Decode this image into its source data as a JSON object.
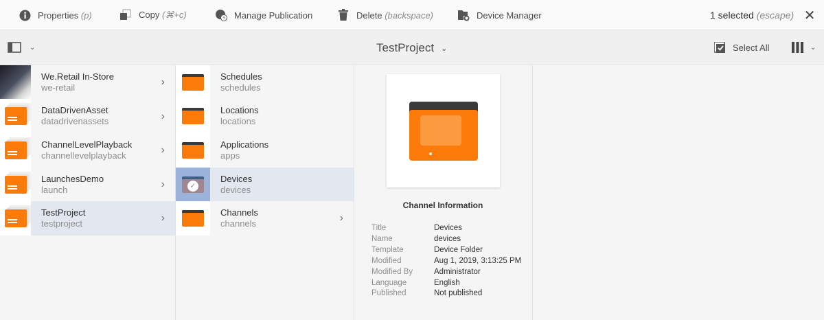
{
  "toolbar": {
    "properties": {
      "label": "Properties",
      "shortcut": "(p)"
    },
    "copy": {
      "label": "Copy",
      "shortcut": "(⌘+c)"
    },
    "manage_publication": {
      "label": "Manage Publication"
    },
    "delete": {
      "label": "Delete",
      "shortcut": "(backspace)"
    },
    "device_manager": {
      "label": "Device Manager"
    },
    "selection": {
      "count": "1 selected",
      "shortcut": "(escape)"
    }
  },
  "header": {
    "title": "TestProject",
    "select_all": "Select All"
  },
  "column1": [
    {
      "title": "We.Retail In-Store",
      "name": "we-retail"
    },
    {
      "title": "DataDrivenAsset",
      "name": "datadrivenassets"
    },
    {
      "title": "ChannelLevelPlayback",
      "name": "channellevelplayback"
    },
    {
      "title": "LaunchesDemo",
      "name": "launch"
    },
    {
      "title": "TestProject",
      "name": "testproject"
    }
  ],
  "column2": [
    {
      "title": "Schedules",
      "name": "schedules"
    },
    {
      "title": "Locations",
      "name": "locations"
    },
    {
      "title": "Applications",
      "name": "apps"
    },
    {
      "title": "Devices",
      "name": "devices"
    },
    {
      "title": "Channels",
      "name": "channels"
    }
  ],
  "preview": {
    "heading": "Channel Information",
    "fields": [
      {
        "k": "Title",
        "v": "Devices"
      },
      {
        "k": "Name",
        "v": "devices"
      },
      {
        "k": "Template",
        "v": "Device Folder"
      },
      {
        "k": "Modified",
        "v": "Aug 1, 2019, 3:13:25 PM"
      },
      {
        "k": "Modified By",
        "v": "Administrator"
      },
      {
        "k": "Language",
        "v": "English"
      },
      {
        "k": "Published",
        "v": "Not published"
      }
    ]
  },
  "colors": {
    "accent": "#fa7a0a",
    "selected_row": "#e3e8f0",
    "selected_thumb": "#9bb3db"
  }
}
